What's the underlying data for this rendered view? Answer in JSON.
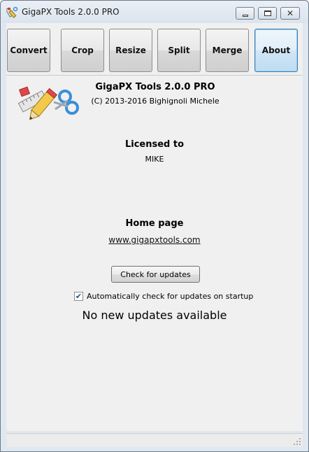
{
  "window": {
    "title": "GigaPX Tools 2.0.0 PRO",
    "controls": {
      "minimize": "minimize",
      "maximize": "maximize",
      "close": "✕"
    }
  },
  "toolbar": {
    "buttons": [
      {
        "label": "Convert",
        "active": false
      },
      {
        "label": "Crop",
        "active": false
      },
      {
        "label": "Resize",
        "active": false
      },
      {
        "label": "Split",
        "active": false
      },
      {
        "label": "Merge",
        "active": false
      },
      {
        "label": "About",
        "active": true
      }
    ]
  },
  "about": {
    "app_name": "GigaPX Tools 2.0.0 PRO",
    "copyright": "(C) 2013-2016 Bighignoli Michele",
    "licensed_label": "Licensed to",
    "licensed_value": "MIKE",
    "home_label": "Home page",
    "home_link": "www.gigapxtools.com",
    "check_button": "Check for updates",
    "auto_check_label": "Automatically check for updates on startup",
    "auto_check_checked": true,
    "status": "No new updates available"
  },
  "icons": {
    "logo": "tools-logo-icon",
    "app": "app-icon"
  },
  "colors": {
    "active_border": "#3c7fb1",
    "panel_bg": "#f0f0f0"
  }
}
